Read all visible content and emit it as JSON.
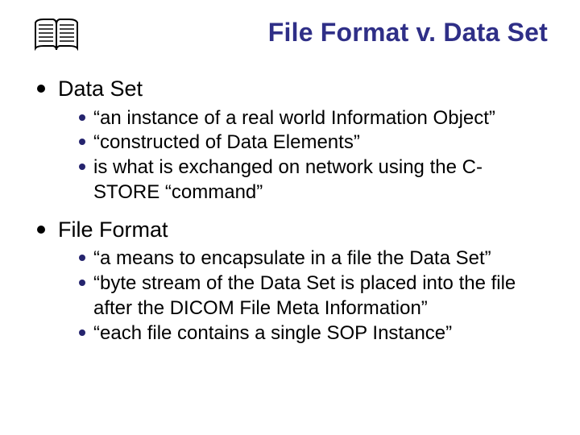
{
  "title": "File Format v. Data Set",
  "sections": [
    {
      "heading": "Data Set",
      "items": [
        "“an instance of a real world Information Object”",
        "“constructed of Data Elements”",
        "is what is exchanged on network using the C-STORE “command”"
      ]
    },
    {
      "heading": "File Format",
      "items": [
        "“a means to encapsulate in a file the Data Set”",
        "“byte stream of the Data Set is placed into the file after the DICOM File Meta Information”",
        "“each file contains a single SOP Instance”"
      ]
    }
  ]
}
